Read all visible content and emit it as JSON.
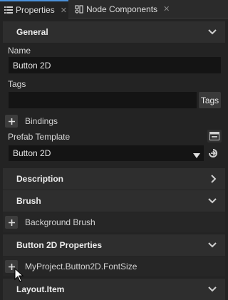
{
  "tabs": [
    {
      "label": "Properties",
      "icon": "list-icon",
      "close": "✕"
    },
    {
      "label": "Node Components",
      "icon": "components-icon",
      "close": "✕"
    }
  ],
  "sections": {
    "general": "General",
    "description": "Description",
    "brush": "Brush",
    "button2d": "Button 2D Properties",
    "layout": "Layout.Item"
  },
  "fields": {
    "name_label": "Name",
    "name_value": "Button 2D",
    "tags_label": "Tags",
    "tags_value": "",
    "tags_button": "Tags",
    "bindings_label": "Bindings",
    "prefab_label": "Prefab Template",
    "prefab_value": "Button 2D",
    "background_brush": "Background Brush",
    "fontsize_property": "MyProject.Button2D.FontSize"
  },
  "colors": {
    "accent": "#4a90d9",
    "panel_bg": "#232323",
    "section_bg": "#2e2e2e"
  }
}
